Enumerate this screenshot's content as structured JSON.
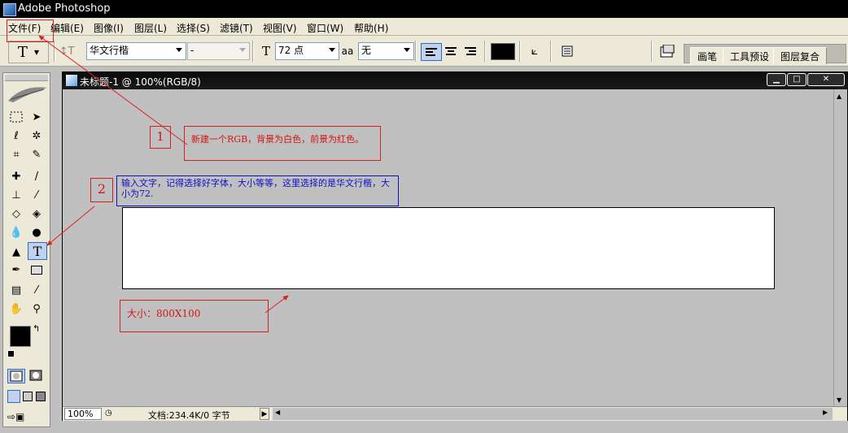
{
  "app": {
    "title": "Adobe Photoshop"
  },
  "menu": {
    "items": [
      {
        "label": "文件(F)"
      },
      {
        "label": "编辑(E)"
      },
      {
        "label": "图像(I)"
      },
      {
        "label": "图层(L)"
      },
      {
        "label": "选择(S)"
      },
      {
        "label": "滤镜(T)"
      },
      {
        "label": "视图(V)"
      },
      {
        "label": "窗口(W)"
      },
      {
        "label": "帮助(H)"
      }
    ]
  },
  "options": {
    "tool_glyph": "T",
    "font_family": "华文行楷",
    "font_style": "-",
    "font_size": "72 点",
    "aa_label": "a",
    "aa_value": "无",
    "color": "#000000"
  },
  "palette_tabs": [
    "画笔",
    "工具预设",
    "图层复合"
  ],
  "document": {
    "title": "未标题-1 @ 100%(RGB/8)",
    "zoom": "100%",
    "doc_info": "文档:234.4K/0 字节"
  },
  "annotations": {
    "step1_number": "1",
    "step1_text": "新建一个RGB，背景为白色，前景为红色。",
    "step2_number": "2",
    "step2_text": "输入文字，记得选择好字体，大小等等，这里选择的是华文行楷，大小为72.",
    "size_text": "大小：800X100"
  },
  "colors": {
    "annotation_red": "#d01515",
    "annotation_blue": "#1010c0",
    "foreground": "#000000",
    "background": "#ffffff"
  }
}
